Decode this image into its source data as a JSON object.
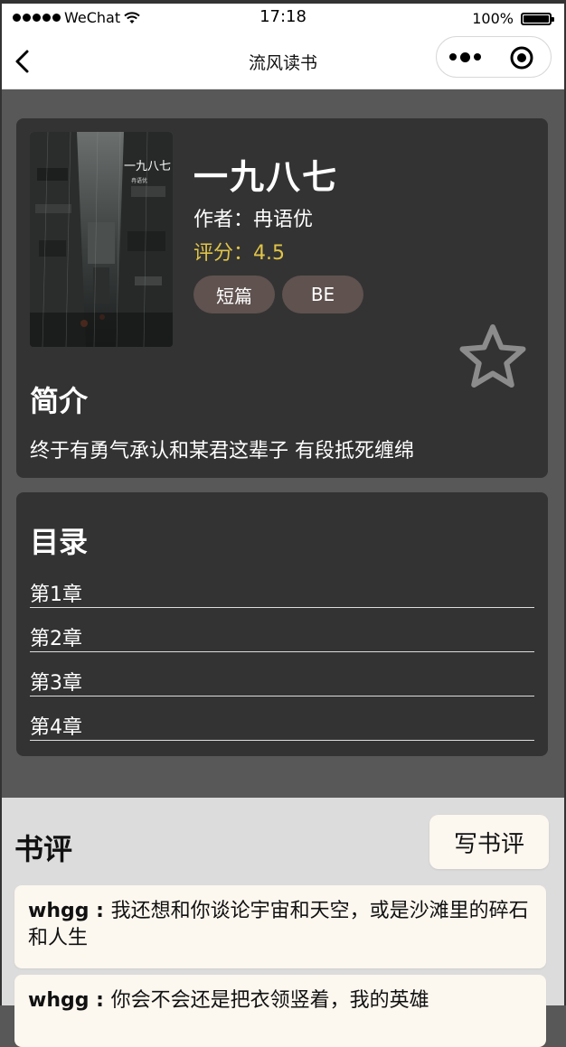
{
  "status_bar": {
    "carrier": "WeChat",
    "time": "17:18",
    "battery": "100%"
  },
  "nav": {
    "title": "流风读书"
  },
  "book": {
    "title": "一九八七",
    "author_label": "作者：",
    "author": "冉语优",
    "rating_label": "评分：",
    "rating": "4.5",
    "tags": [
      "短篇",
      "BE"
    ],
    "intro_title": "简介",
    "intro": "终于有勇气承认和某君这辈子 有段抵死缠绵"
  },
  "toc": {
    "title": "目录",
    "chapters": [
      "第1章",
      "第2章",
      "第3章",
      "第4章"
    ]
  },
  "reviews": {
    "title": "书评",
    "write_label": "写书评",
    "items": [
      {
        "user": "whgg",
        "sep": " : ",
        "text": "我还想和你谈论宇宙和天空，或是沙滩里的碎石和人生"
      },
      {
        "user": "whgg",
        "sep": " : ",
        "text": "你会不会还是把衣领竖着，我的英雄"
      }
    ]
  },
  "colors": {
    "page_bg": "#585858",
    "card_bg": "#333333",
    "rating": "#e0c448",
    "tag_bg": "#5f524f",
    "review_bg": "#fcf7ef",
    "reviews_section_bg": "#dcdcdc"
  },
  "icons": {
    "back": "chevron-left-icon",
    "more": "more-dots-icon",
    "close": "target-circle-icon",
    "favorite": "star-outline-icon"
  }
}
